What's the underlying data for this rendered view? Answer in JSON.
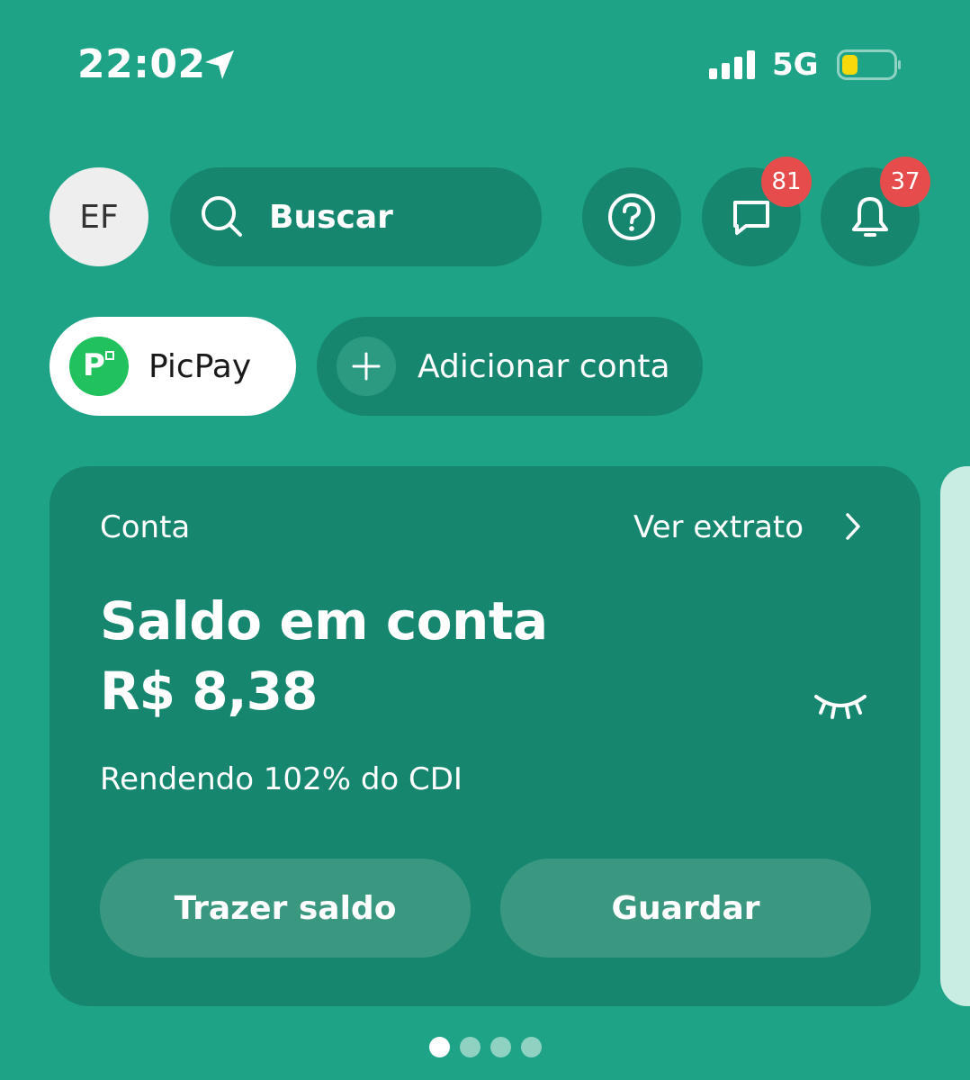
{
  "status_bar": {
    "time": "22:02",
    "network": "5G",
    "icons": [
      "location-arrow-icon",
      "signal-icon",
      "battery-icon"
    ],
    "battery_color": "#f5d90a"
  },
  "header": {
    "avatar_initials": "EF",
    "search_label": "Buscar",
    "chat_badge": "81",
    "notifications_badge": "37"
  },
  "accounts": {
    "items": [
      {
        "label": "PicPay",
        "selected": true
      },
      {
        "label": "Adicionar conta",
        "selected": false
      }
    ]
  },
  "card": {
    "section_label": "Conta",
    "link_label": "Ver extrato",
    "balance_label": "Saldo em conta",
    "balance_value": "R$ 8,38",
    "yield_text": "Rendendo 102% do CDI",
    "buttons": {
      "primary": "Trazer saldo",
      "secondary": "Guardar"
    }
  },
  "pagination": {
    "total": 4,
    "active_index": 0
  },
  "colors": {
    "background": "#1ea386",
    "surface": "#16876e",
    "badge": "#e74c4c",
    "picpay_green": "#21c25e"
  }
}
